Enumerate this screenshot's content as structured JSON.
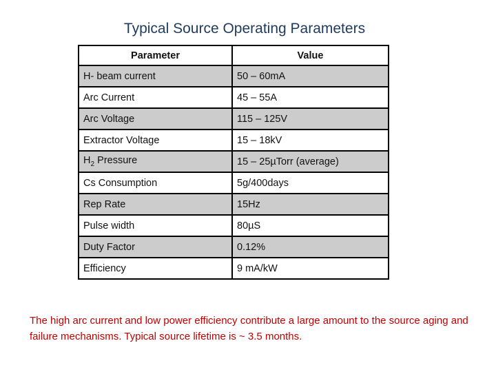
{
  "title": "Typical Source Operating Parameters",
  "table": {
    "headers": [
      "Parameter",
      "Value"
    ],
    "rows": [
      {
        "parameter": "H- beam current",
        "value": "50 – 60mA"
      },
      {
        "parameter": "Arc Current",
        "value": "45 – 55A"
      },
      {
        "parameter": "Arc Voltage",
        "value": "115 – 125V"
      },
      {
        "parameter": "Extractor Voltage",
        "value": "15 – 18kV"
      },
      {
        "parameter_prefix": "H",
        "parameter_sub": "2",
        "parameter_suffix": " Pressure",
        "value": "15 – 25µTorr (average)"
      },
      {
        "parameter": "Cs Consumption",
        "value": "5g/400days"
      },
      {
        "parameter": "Rep Rate",
        "value": "15Hz"
      },
      {
        "parameter": "Pulse width",
        "value": "80µS"
      },
      {
        "parameter": "Duty Factor",
        "value": "0.12%"
      },
      {
        "parameter": "Efficiency",
        "value": "9 mA/kW"
      }
    ],
    "row_shading": [
      "shaded",
      "plain",
      "shaded",
      "plain",
      "shaded",
      "plain",
      "shaded",
      "plain",
      "shaded",
      "plain"
    ]
  },
  "note": "The high arc current and low power efficiency contribute a large amount to the source aging and failure mechanisms. Typical source lifetime is ~ 3.5 months.",
  "colors": {
    "title": "#1f3a5f",
    "note": "#c00000",
    "shaded_row": "#cccccc"
  }
}
